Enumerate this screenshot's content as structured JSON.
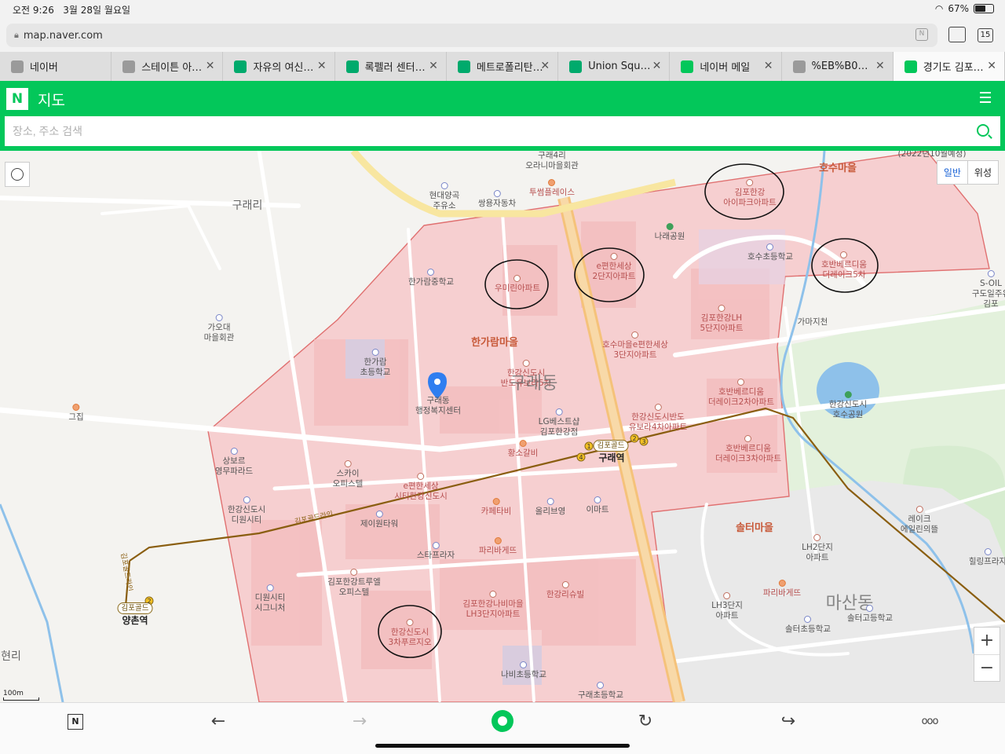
{
  "status": {
    "time": "오전 9:26",
    "date": "3월 28일 월요일",
    "battery": "67%",
    "battery_level": 0.67
  },
  "browser": {
    "url": "map.naver.com",
    "tab_count": "15",
    "tabs": [
      {
        "label": "네이버",
        "icon": "home-icon",
        "color": "#9a9a9a"
      },
      {
        "label": "스테이튼 아…",
        "icon": "globe-icon",
        "color": "#9a9a9a"
      },
      {
        "label": "자유의 여신…",
        "icon": "tripadvisor-icon",
        "color": "#00aa6c"
      },
      {
        "label": "록펠러 센터…",
        "icon": "tripadvisor-icon",
        "color": "#00aa6c"
      },
      {
        "label": "메트로폴리탄…",
        "icon": "tripadvisor-icon",
        "color": "#00aa6c"
      },
      {
        "label": "Union Squ…",
        "icon": "tripadvisor-icon",
        "color": "#00aa6c"
      },
      {
        "label": "네이버 메일",
        "icon": "naver-mail-icon",
        "color": "#03c75a"
      },
      {
        "label": "%EB%B0…",
        "icon": "globe-icon",
        "color": "#9a9a9a"
      },
      {
        "label": "경기도 김포…",
        "icon": "map-pin-icon",
        "color": "#03c75a"
      }
    ]
  },
  "naver": {
    "logo": "N",
    "title": "지도",
    "search_placeholder": "장소, 주소 검색",
    "brand_color": "#03c75a"
  },
  "map": {
    "toggle": {
      "normal": "일반",
      "satellite": "위성"
    },
    "scale": "100m",
    "zoom_in": "+",
    "zoom_out": "−",
    "labels": {
      "guraeri": "구래리",
      "gurae4ri": "구래4리\n오라니마을회관",
      "hyundai": "현대양곡\n주유소",
      "ssangyong": "쌍용자동차",
      "2022": "(2022년10월예정)",
      "tuscan": "투썸플레이스",
      "hosu_maeul": "호수마을",
      "aipark": "김포한강\n아이파크아파트",
      "narae": "나래공원",
      "hosu_school": "호수초등학교",
      "hoban5": "호반베르디움\n더레이크5차",
      "hangaram_mid": "한가람중학교",
      "umirin": "우미린아파트",
      "epyeon2": "e편한세상\n2단지아파트",
      "lh5": "김포한강LH\n5단지아파트",
      "gamaji": "가마지천",
      "soil": "S-OIL\n구도일주유\n김포",
      "gaoedae": "가오대\n마을회관",
      "hangaram_maeul": "한가람마을",
      "hosu_epyeon3": "호수마을e편한세상\n3단지아파트",
      "hangaram_elem": "한가람\n초등학교",
      "bandoyu5": "한강신도시\n반도유보라5차",
      "gurae_dong": "구래동",
      "hoban2": "호반베르디움\n더레이크2차아파트",
      "lake_park": "한강신도시\n호수공원",
      "gujip": "그집",
      "gurae_center": "구래동\n행정복지센터",
      "lg": "LG베스트샵\n김포한강점",
      "bando4": "한강신도시반도\n유보라4차아파트",
      "hwangso": "황소갈비",
      "gurae_station": "구래역",
      "hoban3": "호반베르디움\n더레이크3차아파트",
      "sangbore": "상보르\n영무파라드",
      "sky": "스카이\n오피스텔",
      "epyeon_city": "e편한세상\n시티한강신도시",
      "cafe": "카페타비",
      "olive": "올리브영",
      "emart": "이마트",
      "reike": "레이크\n에일린의뜰",
      "diwon": "한강신도시\n디원시티",
      "goldline": "김포골드라인",
      "j1": "제이원타워",
      "solter": "솔터마을",
      "starplaza": "스타프라자",
      "paris1": "파리바게뜨",
      "lh2": "LH2단지\n아파트",
      "hilling": "힐링프라자",
      "hangang_tower": "김포한강트루엘\n오피스텔",
      "diwon_sig": "디원시티\n시그니처",
      "nabi": "김포한강나비마을\nLH3단지아파트",
      "swill": "한강리슈빌",
      "paris2": "파리바게뜨",
      "lh3": "LH3단지\n아파트",
      "masan": "마산동",
      "yangchon": "양촌역",
      "hangang3": "한강신도시\n3차푸르지오",
      "solter_school": "솔터초등학교",
      "solter_high": "솔터고등학교",
      "hyeonri": "현리",
      "nabi_school": "나비초등학교",
      "gurae_school": "구래초등학교",
      "goldline_v": "김포골드라인",
      "gold_badge": "김포골드",
      "gold_badge2": "김포골드",
      "n1": "1",
      "n2": "2",
      "n3": "3",
      "n4": "4",
      "n2b": "2"
    }
  },
  "toolbar": {
    "home": "N",
    "back": "←",
    "forward": "→",
    "reload": "↻",
    "share": "↪",
    "more": "ooo"
  }
}
